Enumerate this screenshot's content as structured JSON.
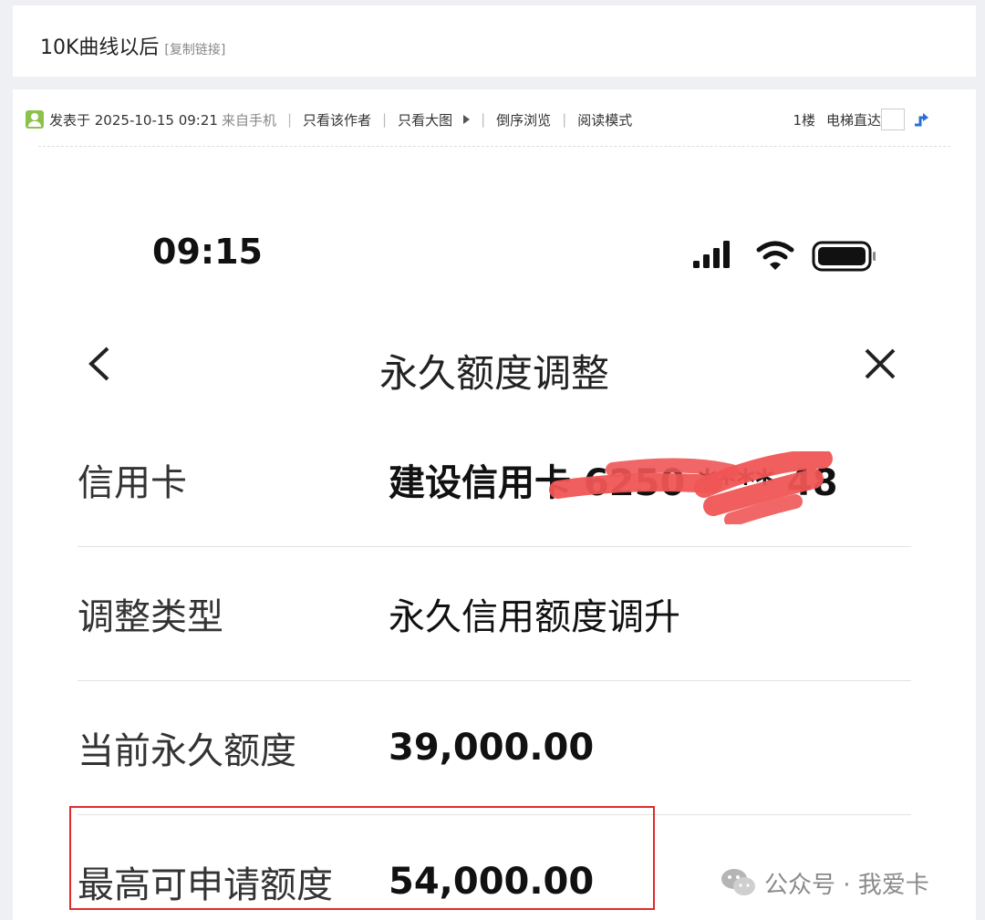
{
  "thread": {
    "title": "10K曲线以后",
    "copy_link": "[复制链接]"
  },
  "post_meta": {
    "posted_at": "发表于 2025-10-15 09:21",
    "source": "来自手机",
    "author_only": "只看该作者",
    "large_image": "只看大图",
    "reverse": "倒序浏览",
    "read_mode": "阅读模式",
    "floor": "1楼",
    "elevator": "电梯直达"
  },
  "phone": {
    "time": "09:15",
    "nav_title": "永久额度调整",
    "rows": [
      {
        "label": "信用卡",
        "value": "建设信用卡 6250 **** 48"
      },
      {
        "label": "调整类型",
        "value": "永久信用额度调升"
      },
      {
        "label": "当前永久额度",
        "value": "39,000.00"
      },
      {
        "label": "最高可申请额度",
        "value": "54,000.00"
      }
    ]
  },
  "watermark": {
    "text": "公众号 · 我爱卡"
  },
  "colors": {
    "highlight": "#e02a2a",
    "redact": "#f05555"
  }
}
